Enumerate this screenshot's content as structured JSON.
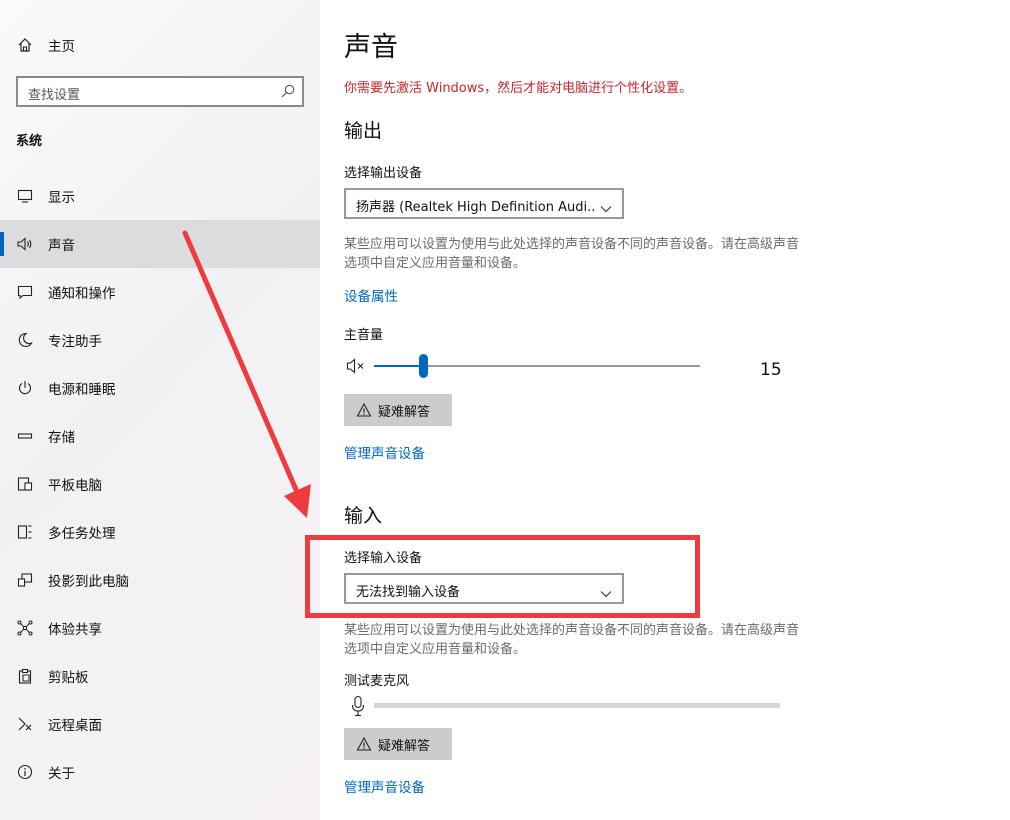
{
  "sidebar": {
    "home_label": "主页",
    "search_placeholder": "查找设置",
    "section_title": "系统",
    "items": [
      {
        "label": "显示",
        "icon": "monitor-icon"
      },
      {
        "label": "声音",
        "icon": "speaker-icon",
        "active": true
      },
      {
        "label": "通知和操作",
        "icon": "notification-icon"
      },
      {
        "label": "专注助手",
        "icon": "moon-icon"
      },
      {
        "label": "电源和睡眠",
        "icon": "power-icon"
      },
      {
        "label": "存储",
        "icon": "storage-icon"
      },
      {
        "label": "平板电脑",
        "icon": "tablet-icon"
      },
      {
        "label": "多任务处理",
        "icon": "multitask-icon"
      },
      {
        "label": "投影到此电脑",
        "icon": "project-icon"
      },
      {
        "label": "体验共享",
        "icon": "share-icon"
      },
      {
        "label": "剪贴板",
        "icon": "clipboard-icon"
      },
      {
        "label": "远程桌面",
        "icon": "remote-icon"
      },
      {
        "label": "关于",
        "icon": "info-icon"
      }
    ]
  },
  "main": {
    "title": "声音",
    "warning": "你需要先激活 Windows，然后才能对电脑进行个性化设置。",
    "output": {
      "section_title": "输出",
      "device_label": "选择输出设备",
      "device_value": "扬声器 (Realtek High Definition Audi...",
      "description": "某些应用可以设置为使用与此处选择的声音设备不同的声音设备。请在高级声音选项中自定义应用音量和设备。",
      "properties_link": "设备属性",
      "volume_label": "主音量",
      "volume_value": "15",
      "troubleshoot_label": "疑难解答",
      "manage_link": "管理声音设备"
    },
    "input": {
      "section_title": "输入",
      "device_label": "选择输入设备",
      "device_value": "无法找到输入设备",
      "description": "某些应用可以设置为使用与此处选择的声音设备不同的声音设备。请在高级声音选项中自定义应用音量和设备。",
      "test_label": "测试麦克风",
      "troubleshoot_label": "疑难解答",
      "manage_link": "管理声音设备"
    }
  },
  "colors": {
    "accent": "#0067c0",
    "warning": "#c4262e",
    "annotation": "#ef3b3f"
  }
}
